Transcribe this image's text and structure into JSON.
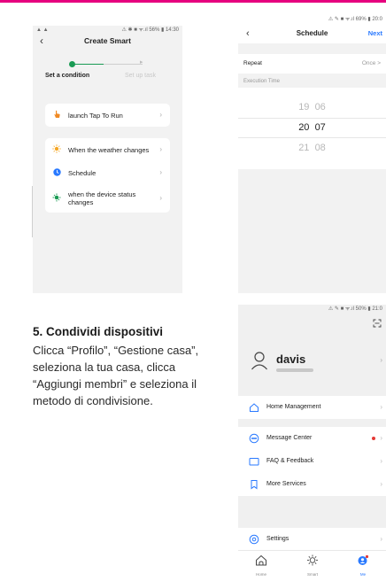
{
  "phone1": {
    "status_left": "▲ ▲",
    "status_right": "⚠ ✱ ■ ᯤ.ıl 56% ▮ 14:30",
    "back_icon": "chevron-left-icon",
    "title": "Create Smart",
    "step_active": "Set a condition",
    "step_inactive": "Set up task",
    "items": [
      {
        "label": "launch Tap To Run",
        "icon": "hand-tap-icon",
        "color": "#f08a24"
      },
      {
        "label": "When the weather changes",
        "icon": "sun-icon",
        "color": "#f5a623"
      },
      {
        "label": "Schedule",
        "icon": "clock-icon",
        "color": "#2979ff"
      },
      {
        "label": "when the device status changes",
        "icon": "device-icon",
        "color": "#1a9b54"
      }
    ]
  },
  "phone2": {
    "status_right": "⚠ ✎ ■ ᯤ.ıl 69% ▮ 20:0",
    "title": "Schedule",
    "next": "Next",
    "repeat_label": "Repeat",
    "repeat_value": "Once  >",
    "execution_label": "Execution Time",
    "times": [
      {
        "h": "19",
        "m": "06"
      },
      {
        "h": "20",
        "m": "07"
      },
      {
        "h": "21",
        "m": "08"
      }
    ]
  },
  "phone3": {
    "status_right": "⚠ ✎ ■ ᯤ.ıl 50% ▮ 21:0",
    "user_name": "davis",
    "menu_group1": [
      {
        "label": "Home Management",
        "icon": "home-outline-icon"
      }
    ],
    "menu_group2": [
      {
        "label": "Message Center",
        "icon": "message-icon",
        "badge": true
      },
      {
        "label": "FAQ & Feedback",
        "icon": "faq-icon"
      },
      {
        "label": "More Services",
        "icon": "bookmark-icon"
      }
    ],
    "menu_group3": [
      {
        "label": "Settings",
        "icon": "settings-icon"
      }
    ],
    "tabs": [
      {
        "label": "Home",
        "icon": "home-tab-icon"
      },
      {
        "label": "Smart",
        "icon": "smart-tab-icon"
      },
      {
        "label": "Me",
        "icon": "me-tab-icon",
        "active": true
      }
    ]
  },
  "instructions": {
    "heading": "5. Condividi dispositivi",
    "body": "Clicca “Profilo”, “Gestione casa”, seleziona la tua casa, clicca “Aggiungi membri” e seleziona il metodo di condivisione."
  },
  "colors": {
    "accent_bar": "#e6007e",
    "green": "#1a9b54",
    "blue": "#2979ff"
  }
}
